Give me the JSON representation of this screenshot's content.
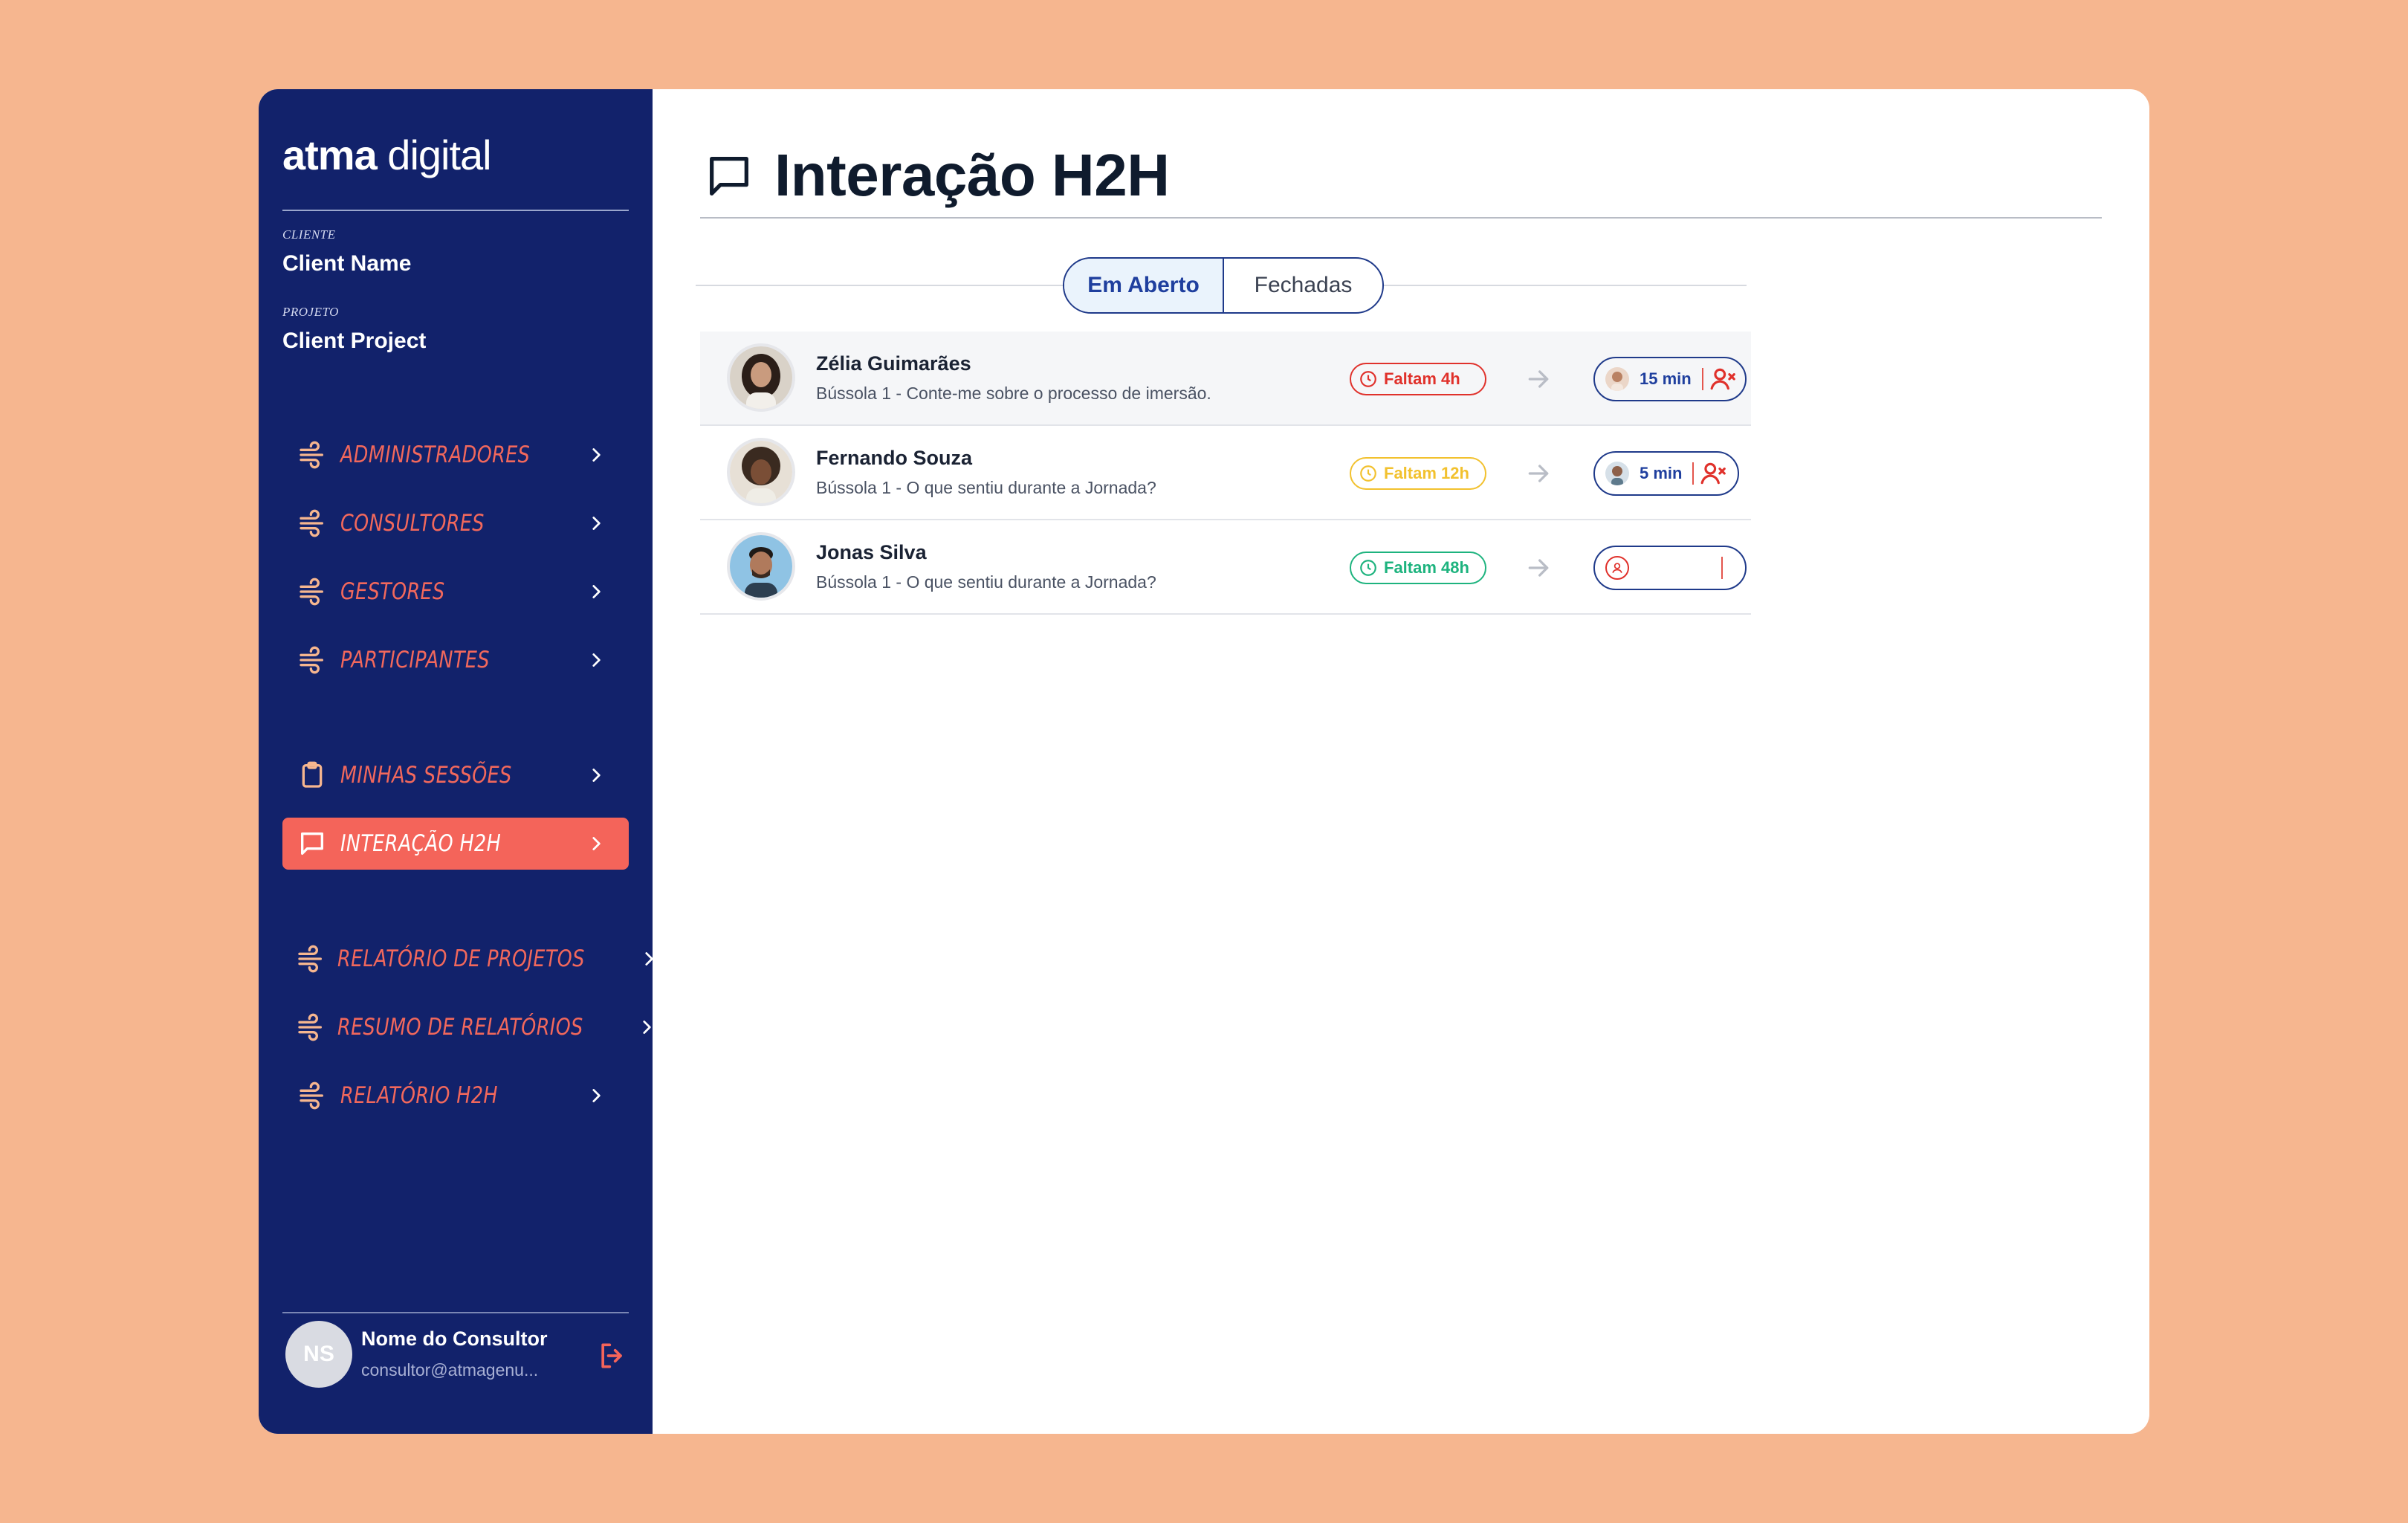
{
  "brand": {
    "bold": "atma",
    "light": " digital"
  },
  "client": {
    "label": "CLIENTE",
    "value": "Client Name"
  },
  "project": {
    "label": "PROJETO",
    "value": "Client Project"
  },
  "nav": [
    {
      "label": "ADMINISTRADORES",
      "icon": "wind-icon"
    },
    {
      "label": "CONSULTORES",
      "icon": "wind-icon"
    },
    {
      "label": "GESTORES",
      "icon": "wind-icon"
    },
    {
      "label": "PARTICIPANTES",
      "icon": "wind-icon"
    },
    {
      "label": "MINHAS SESSÕES",
      "icon": "clipboard-icon"
    },
    {
      "label": "INTERAÇÃO H2H",
      "icon": "chat-icon",
      "active": true
    },
    {
      "label": "RELATÓRIO DE PROJETOS",
      "icon": "wind-icon"
    },
    {
      "label": "RESUMO DE RELATÓRIOS",
      "icon": "wind-icon"
    },
    {
      "label": "RELATÓRIO H2H",
      "icon": "wind-icon"
    }
  ],
  "user": {
    "initials": "NS",
    "name": "Nome do Consultor",
    "email": "consultor@atmagenu..."
  },
  "page": {
    "title": "Interação H2H"
  },
  "tabs": {
    "open": "Em Aberto",
    "closed": "Fechadas",
    "selected": "Em Aberto"
  },
  "rows": [
    {
      "name": "Zélia Guimarães",
      "subtitle": "Bússola 1 - Conte-me sobre o processo de imersão.",
      "deadline": "Faltam 4h",
      "deadline_color": "#E0312B",
      "time": "15 min"
    },
    {
      "name": "Fernando Souza",
      "subtitle": "Bússola 1 - O que sentiu durante a Jornada?",
      "deadline": "Faltam 12h",
      "deadline_color": "#F2C12E",
      "time": "5 min"
    },
    {
      "name": "Jonas Silva",
      "subtitle": "Bússola 1 - O que sentiu durante a Jornada?",
      "deadline": "Faltam 48h",
      "deadline_color": "#1DB37E",
      "time": ""
    }
  ],
  "colors": {
    "sidebar": "#12226B",
    "accent": "#F4645A",
    "primary": "#1F3A8A",
    "background": "#F6B68F"
  }
}
